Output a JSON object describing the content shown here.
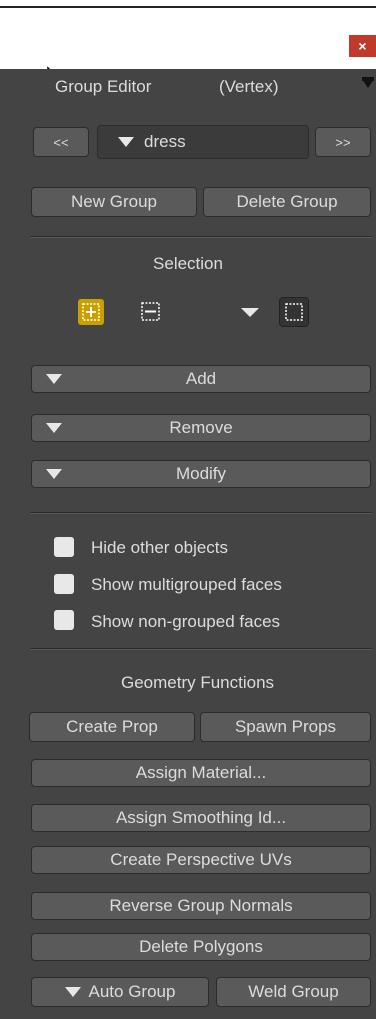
{
  "window": {
    "close_glyph": "×"
  },
  "panel": {
    "title": "Group Editor",
    "mode": "(Vertex)"
  },
  "group_nav": {
    "prev_label": "<<",
    "group_name": "dress",
    "next_label": ">>"
  },
  "group_buttons": {
    "new_group": "New Group",
    "delete_group": "Delete Group"
  },
  "selection": {
    "heading": "Selection",
    "dropdowns": {
      "add": "Add",
      "remove": "Remove",
      "modify": "Modify"
    }
  },
  "options": [
    {
      "label": "Hide other objects",
      "checked": false
    },
    {
      "label": "Show multigrouped faces",
      "checked": false
    },
    {
      "label": "Show non-grouped faces",
      "checked": false
    }
  ],
  "geometry": {
    "heading": "Geometry Functions",
    "create_prop": "Create Prop",
    "spawn_props": "Spawn Props",
    "assign_material": "Assign Material...",
    "assign_smoothing": "Assign Smoothing Id...",
    "create_uvs": "Create Perspective UVs",
    "reverse_normals": "Reverse Group Normals",
    "delete_polygons": "Delete Polygons",
    "auto_group": "Auto Group",
    "weld_group": "Weld Group"
  },
  "colors": {
    "panel_bg": "#444444",
    "button_bg": "#5a5a5a",
    "accent_active": "#c8a000",
    "close_red": "#c0392b"
  }
}
